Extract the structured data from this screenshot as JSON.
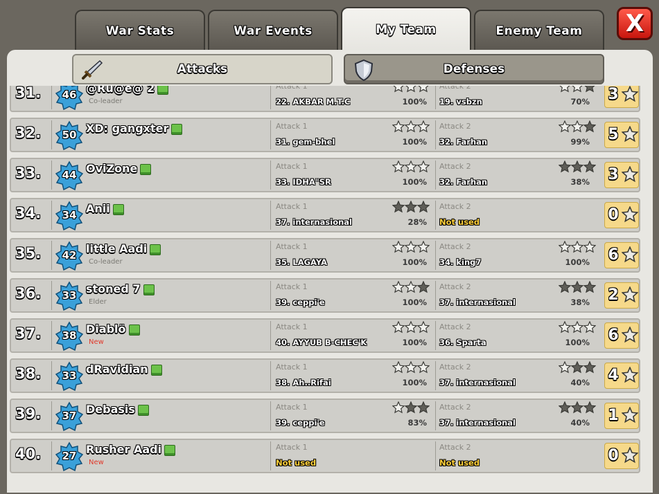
{
  "tabs": [
    {
      "label": "War Stats",
      "active": false
    },
    {
      "label": "War Events",
      "active": false
    },
    {
      "label": "My Team",
      "active": true
    },
    {
      "label": "Enemy Team",
      "active": false
    }
  ],
  "close_label": "X",
  "subtabs": {
    "attacks_label": "Attacks",
    "defenses_label": "Defenses"
  },
  "attack1_label": "Attack 1",
  "attack2_label": "Attack 2",
  "colors": {
    "gold_star": "#f2f2ee",
    "dark_star": "#5f5e58",
    "score_bg": "#f6d98a",
    "not_used": "#ffcf3a",
    "badge": "#3aa0d9"
  },
  "rows": [
    {
      "rank": "31.",
      "level": "46",
      "name": "@Rū@е@ 2",
      "role": "Co-leader",
      "role_new": false,
      "a1": {
        "target": "22. AKBAR M.T.C",
        "pct": "100%",
        "stars": 3,
        "used": true
      },
      "a2": {
        "target": "19. vsbzn",
        "pct": "70%",
        "stars": 2,
        "used": true
      },
      "score": "3"
    },
    {
      "rank": "32.",
      "level": "50",
      "name": "XD: gangxter",
      "role": "",
      "role_new": false,
      "a1": {
        "target": "31. gem-bhel",
        "pct": "100%",
        "stars": 3,
        "used": true
      },
      "a2": {
        "target": "32. Farhan",
        "pct": "99%",
        "stars": 2,
        "used": true
      },
      "score": "5"
    },
    {
      "rank": "33.",
      "level": "44",
      "name": "OviZone",
      "role": "",
      "role_new": false,
      "a1": {
        "target": "33. IDHA\"SR",
        "pct": "100%",
        "stars": 3,
        "used": true
      },
      "a2": {
        "target": "32. Farhan",
        "pct": "38%",
        "stars": 0,
        "used": true
      },
      "score": "3"
    },
    {
      "rank": "34.",
      "level": "34",
      "name": "Anii",
      "role": "",
      "role_new": false,
      "a1": {
        "target": "37. internasional",
        "pct": "28%",
        "stars": 0,
        "used": true
      },
      "a2": {
        "target": "Not used",
        "pct": "",
        "stars": -1,
        "used": false
      },
      "score": "0"
    },
    {
      "rank": "35.",
      "level": "42",
      "name": "little Aadi",
      "role": "Co-leader",
      "role_new": false,
      "a1": {
        "target": "35. LAGAYA",
        "pct": "100%",
        "stars": 3,
        "used": true
      },
      "a2": {
        "target": "34. king7",
        "pct": "100%",
        "stars": 3,
        "used": true
      },
      "score": "6"
    },
    {
      "rank": "36.",
      "level": "33",
      "name": "stoned 7",
      "role": "Elder",
      "role_new": false,
      "a1": {
        "target": "39. ceppi'e",
        "pct": "100%",
        "stars": 2,
        "used": true
      },
      "a2": {
        "target": "37. internasional",
        "pct": "38%",
        "stars": 0,
        "used": true
      },
      "score": "2"
    },
    {
      "rank": "37.",
      "level": "38",
      "name": "Diablö",
      "role": "New",
      "role_new": true,
      "a1": {
        "target": "40. AYYUB B-CHEC'K",
        "pct": "100%",
        "stars": 3,
        "used": true
      },
      "a2": {
        "target": "36. Sparta",
        "pct": "100%",
        "stars": 3,
        "used": true
      },
      "score": "6"
    },
    {
      "rank": "38.",
      "level": "33",
      "name": "dRavidian",
      "role": "",
      "role_new": false,
      "a1": {
        "target": "38. Ah..Rifai",
        "pct": "100%",
        "stars": 3,
        "used": true
      },
      "a2": {
        "target": "37. internasional",
        "pct": "40%",
        "stars": 1,
        "used": true
      },
      "score": "4"
    },
    {
      "rank": "39.",
      "level": "37",
      "name": "Debasis",
      "role": "",
      "role_new": false,
      "a1": {
        "target": "39. ceppi'e",
        "pct": "83%",
        "stars": 1,
        "used": true
      },
      "a2": {
        "target": "37. internasional",
        "pct": "40%",
        "stars": 0,
        "used": true
      },
      "score": "1"
    },
    {
      "rank": "40.",
      "level": "27",
      "name": "Rusher Aadi",
      "role": "New",
      "role_new": true,
      "a1": {
        "target": "Not used",
        "pct": "",
        "stars": -1,
        "used": false
      },
      "a2": {
        "target": "Not used",
        "pct": "",
        "stars": -1,
        "used": false
      },
      "score": "0"
    }
  ]
}
